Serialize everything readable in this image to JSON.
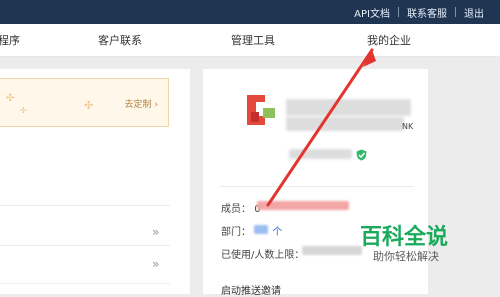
{
  "top_links": [
    "API文档",
    "联系客服",
    "退出"
  ],
  "nav": {
    "items": [
      "程序",
      "客户联系",
      "管理工具",
      "我的企业"
    ]
  },
  "left": {
    "banner_link": "去定制 ›",
    "chevrons": [
      "»",
      "»"
    ]
  },
  "company": {
    "suffix": "NK",
    "fields": [
      {
        "label": "成员：",
        "value": "0"
      },
      {
        "label": "部门：",
        "value": "个"
      },
      {
        "label": "已使用/人数上限：",
        "value": ""
      }
    ]
  },
  "bottom_text": "启动推送邀请",
  "watermark": {
    "title": "百科全说",
    "subtitle": "助你轻松解决"
  },
  "colors": {
    "topbar": "#1f3552",
    "accent_red": "#e3342f",
    "watermark_green": "#1aaa5b",
    "badge_green": "#32b86b"
  },
  "icons": [
    "red-annotation-arrow-icon",
    "verified-shield-icon"
  ]
}
